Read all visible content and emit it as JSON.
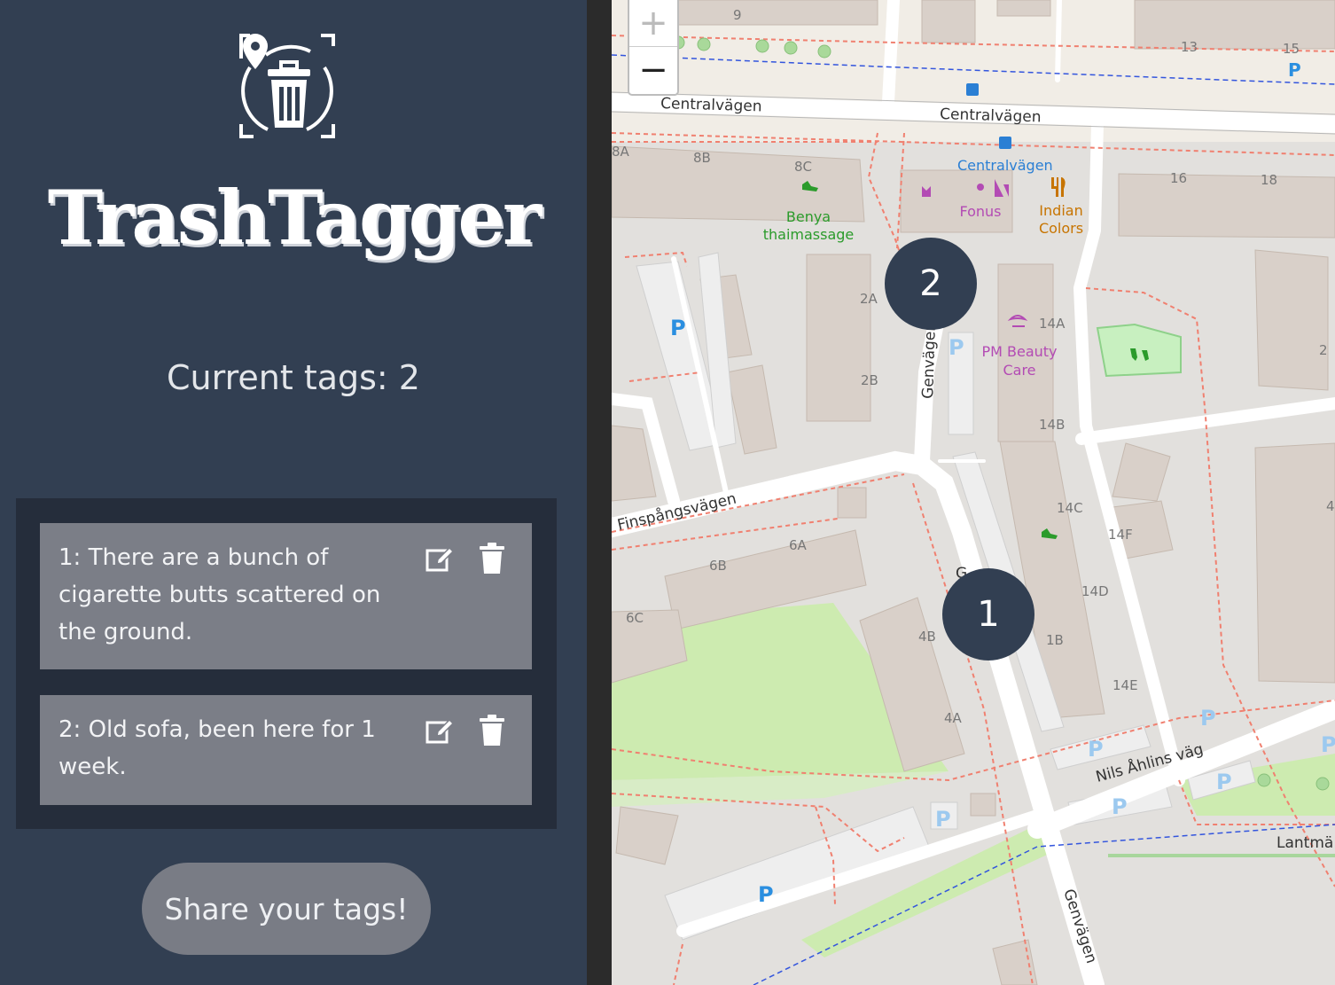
{
  "app": {
    "title": "TrashTagger"
  },
  "sidebar": {
    "count_label": "Current tags: 2",
    "tags": [
      {
        "text": "1: There are a bunch of cigarette butts scattered on the ground."
      },
      {
        "text": "2: Old sofa, been here for 1 week."
      }
    ],
    "share_label": "Share your tags!"
  },
  "map": {
    "zoom_in": "+",
    "zoom_out": "−",
    "markers": [
      "1",
      "2"
    ],
    "streets": [
      "Centralvägen",
      "Centralvägen",
      "Centralvägen",
      "Finspångsvägen",
      "Genvägen",
      "Genvägen",
      "Nils Åhlins väg",
      "Lantmä",
      "G"
    ],
    "pois": [
      "Benya",
      "thaimassage",
      "Fonus",
      "Indian",
      "Colors",
      "PM Beauty",
      "Care"
    ],
    "house_numbers": [
      "9",
      "13",
      "15",
      "8A",
      "8B",
      "8C",
      "16",
      "18",
      "2A",
      "2B",
      "14A",
      "2",
      "14B",
      "14C",
      "14F",
      "6A",
      "6B",
      "6C",
      "4B",
      "4A",
      "1B",
      "14D",
      "14E",
      "4"
    ],
    "parking": [
      "P"
    ]
  },
  "colors": {
    "sidebar_bg": "#323f52",
    "panel_bg": "#252d3b",
    "card_bg": "#7b7e87",
    "marker_bg": "#323f52"
  }
}
